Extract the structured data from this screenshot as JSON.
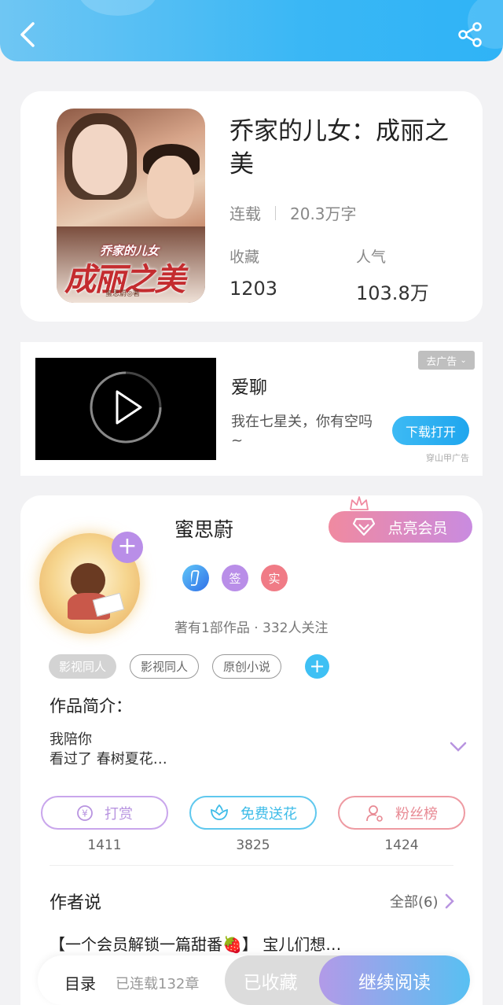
{
  "header": {
    "back_icon": "chevron-left-icon",
    "share_icon": "share-icon"
  },
  "book": {
    "title": "乔家的儿女：成丽之美",
    "cover": {
      "subtitle": "乔家的儿女",
      "title": "成丽之美",
      "author": "蜜思蔚◎著"
    },
    "status": "连载",
    "word_count": "20.3万字",
    "favorites_label": "收藏",
    "favorites_value": "1203",
    "popularity_label": "人气",
    "popularity_value": "103.8万"
  },
  "ad": {
    "title": "爱聊",
    "description": "我在七星关，你有空吗~",
    "remove_label": "去广告",
    "download_label": "下载打开",
    "source": "穿山甲广告"
  },
  "author": {
    "name": "蜜思蔚",
    "vip_label": "点亮会员",
    "badges": [
      {
        "text": "",
        "color": "#3a8ef0"
      },
      {
        "text": "签",
        "color": "#b98ee8"
      },
      {
        "text": "实",
        "color": "#f07b86"
      }
    ],
    "works_info": "著有1部作品 · 332人关注",
    "tags": [
      "影视同人",
      "影视同人",
      "原创小说"
    ],
    "intro_heading": "作品简介：",
    "intro_text": "我陪你\n看过了  春树夏花…"
  },
  "actions": [
    {
      "label": "打赏",
      "count": "1411",
      "color": "#b894e0",
      "icon": "yen-icon"
    },
    {
      "label": "免费送花",
      "count": "3825",
      "color": "#3ebce8",
      "icon": "flower-icon"
    },
    {
      "label": "粉丝榜",
      "count": "1424",
      "color": "#e88a94",
      "icon": "user-icon"
    }
  ],
  "author_says": {
    "heading": "作者说",
    "all_label": "全部(6)",
    "post": "【一个会员解锁一篇甜番🍓】 宝儿们想…"
  },
  "bottom": {
    "toc_label": "目录",
    "chapters": "已连载132章",
    "favorited_label": "已收藏",
    "read_label": "继续阅读"
  }
}
